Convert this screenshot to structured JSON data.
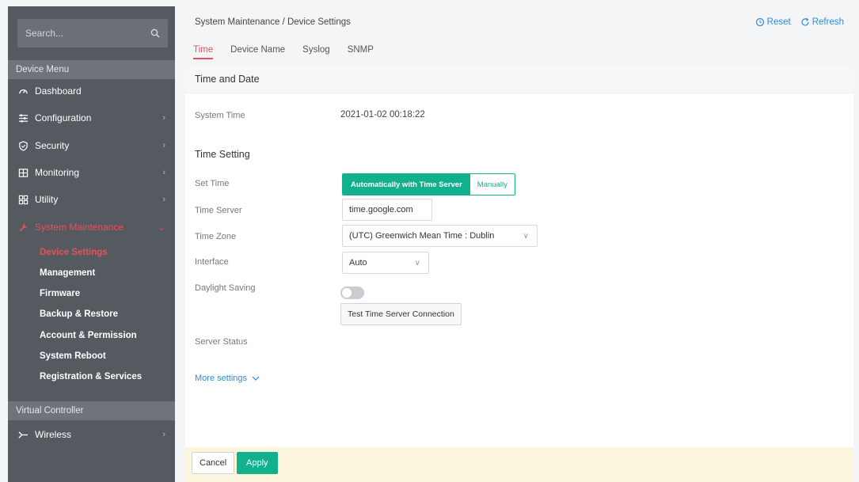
{
  "sidebar": {
    "search_placeholder": "Search...",
    "device_menu_header": "Device Menu",
    "items": [
      {
        "label": "Dashboard",
        "icon": "dashboard-icon"
      },
      {
        "label": "Configuration",
        "icon": "sliders-icon"
      },
      {
        "label": "Security",
        "icon": "shield-icon"
      },
      {
        "label": "Monitoring",
        "icon": "monitor-icon"
      },
      {
        "label": "Utility",
        "icon": "grid-icon"
      },
      {
        "label": "System Maintenance",
        "icon": "wrench-icon"
      }
    ],
    "sub_items": [
      {
        "label": "Device Settings"
      },
      {
        "label": "Management"
      },
      {
        "label": "Firmware"
      },
      {
        "label": "Backup & Restore"
      },
      {
        "label": "Account & Permission"
      },
      {
        "label": "System Reboot"
      },
      {
        "label": "Registration & Services"
      }
    ],
    "virtual_controller_header": "Virtual Controller",
    "wireless_label": "Wireless"
  },
  "header": {
    "breadcrumb": "System Maintenance / Device Settings",
    "reset_label": "Reset",
    "refresh_label": "Refresh"
  },
  "tabs": [
    {
      "label": "Time"
    },
    {
      "label": "Device Name"
    },
    {
      "label": "Syslog"
    },
    {
      "label": "SNMP"
    }
  ],
  "main": {
    "section_title": "Time and Date",
    "system_time_label": "System Time",
    "system_time_value": "2021-01-02 00:18:22",
    "time_setting_title": "Time Setting",
    "set_time_label": "Set Time",
    "set_time_auto": "Automatically with Time Server",
    "set_time_manual": "Manually",
    "time_server_label": "Time Server",
    "time_server_value": "time.google.com",
    "time_zone_label": "Time Zone",
    "time_zone_value": "(UTC) Greenwich Mean Time : Dublin",
    "interface_label": "Interface",
    "interface_value": "Auto",
    "daylight_label": "Daylight Saving",
    "test_button": "Test Time Server Connection",
    "server_status_label": "Server Status",
    "more_settings": "More settings"
  },
  "footer": {
    "cancel_label": "Cancel",
    "apply_label": "Apply"
  },
  "colors": {
    "accent_red": "#e8505b",
    "accent_green": "#12b08c",
    "link_blue": "#2a8dd4",
    "sidebar_bg": "#545a5f"
  }
}
